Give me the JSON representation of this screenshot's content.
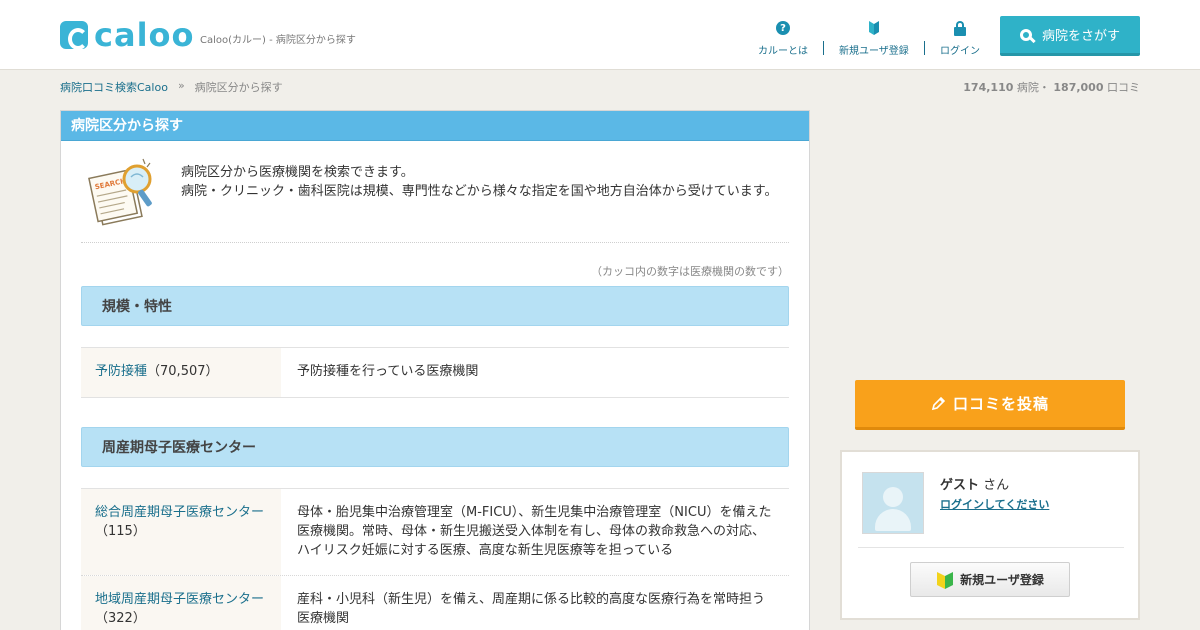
{
  "header": {
    "logo_text": "caloo",
    "tagline": "Caloo(カルー) - 病院区分から探す",
    "nav": [
      {
        "label": "カルーとは",
        "icon": "question-icon"
      },
      {
        "label": "新規ユーザ登録",
        "icon": "beginner-leaf-icon"
      },
      {
        "label": "ログイン",
        "icon": "lock-icon"
      }
    ],
    "search_button": "病院をさがす"
  },
  "breadcrumb": {
    "home": "病院口コミ検索Caloo",
    "separator": "»",
    "current": "病院区分から探す"
  },
  "counts": {
    "hospitals": "174,110",
    "hospitals_unit": "病院・",
    "reviews": "187,000",
    "reviews_unit": "口コミ"
  },
  "panel": {
    "title": "病院区分から探す",
    "intro_line1": "病院区分から医療機関を検索できます。",
    "intro_line2": "病院・クリニック・歯科医院は規模、専門性などから様々な指定を国や地方自治体から受けています。",
    "note": "（カッコ内の数字は医療機関の数です）",
    "sections": [
      {
        "title": "規模・特性",
        "rows": [
          {
            "name": "予防接種",
            "count": "（70,507）",
            "desc": "予防接種を行っている医療機関"
          }
        ]
      },
      {
        "title": "周産期母子医療センター",
        "rows": [
          {
            "name": "総合周産期母子医療センター",
            "count": "（115）",
            "desc": "母体・胎児集中治療管理室（M-FICU）、新生児集中治療管理室（NICU）を備えた医療機関。常時、母体・新生児搬送受入体制を有し、母体の救命救急への対応、ハイリスク妊娠に対する医療、高度な新生児医療等を担っている"
          },
          {
            "name": "地域周産期母子医療センター",
            "count": "（322）",
            "desc": "産科・小児科（新生児）を備え、周産期に係る比較的高度な医療行為を常時担う医療機関"
          }
        ]
      }
    ]
  },
  "sidebar": {
    "post_button": "口コミを投稿",
    "guest_name": "ゲスト",
    "guest_suffix": "さん",
    "login_link": "ログインしてください",
    "register_button": "新規ユーザ登録"
  },
  "colors": {
    "brand": "#3ab4d6",
    "search_button": "#2fb2c8",
    "panel_header": "#5bb8e6",
    "section_header": "#b7e1f5",
    "post_button": "#f9a11b",
    "link": "#1a6f8c"
  }
}
